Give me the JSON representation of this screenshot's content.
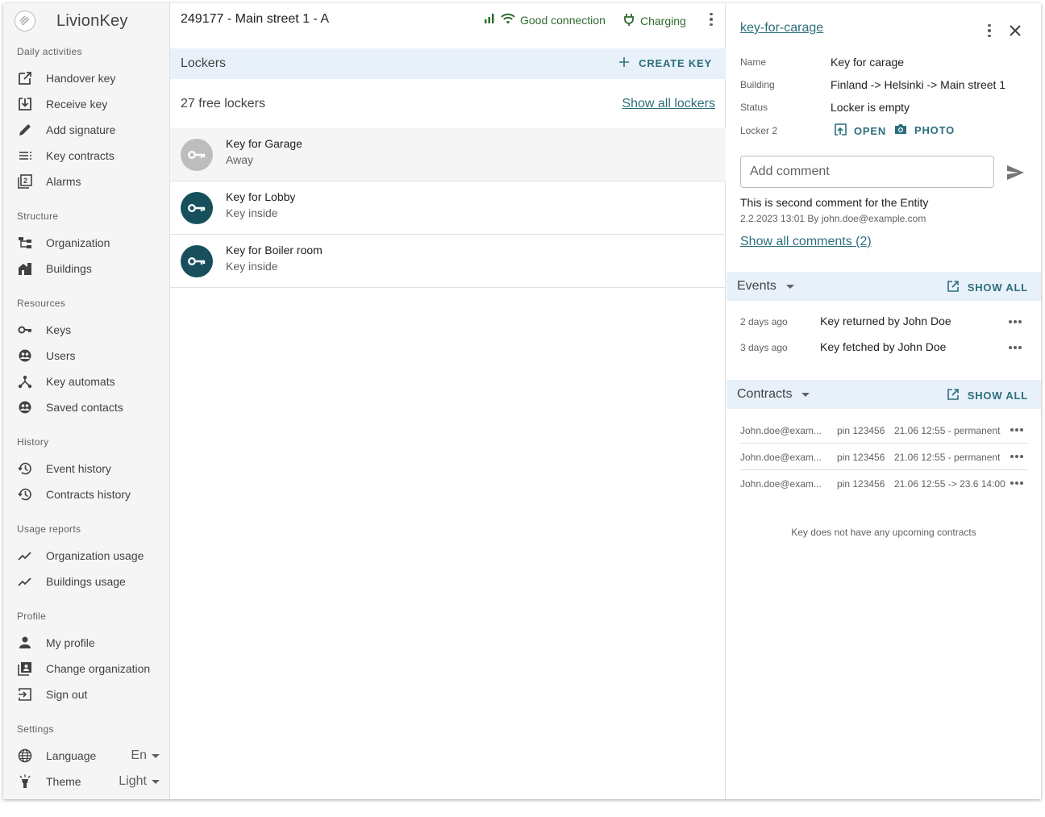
{
  "app": {
    "name": "LivionKey"
  },
  "sidebar": {
    "sections": [
      {
        "title": "Daily activities",
        "items": [
          {
            "label": "Handover key",
            "icon": "handover-icon"
          },
          {
            "label": "Receive key",
            "icon": "receive-icon"
          },
          {
            "label": "Add signature",
            "icon": "pencil-icon"
          },
          {
            "label": "Key contracts",
            "icon": "list-icon"
          },
          {
            "label": "Alarms",
            "icon": "alarm-icon"
          }
        ]
      },
      {
        "title": "Structure",
        "items": [
          {
            "label": "Organization",
            "icon": "organization-icon"
          },
          {
            "label": "Buildings",
            "icon": "buildings-icon"
          }
        ]
      },
      {
        "title": "Resources",
        "items": [
          {
            "label": "Keys",
            "icon": "key-icon"
          },
          {
            "label": "Users",
            "icon": "users-icon"
          },
          {
            "label": "Key automats",
            "icon": "automats-icon"
          },
          {
            "label": "Saved contacts",
            "icon": "contacts-icon"
          }
        ]
      },
      {
        "title": "History",
        "items": [
          {
            "label": "Event history",
            "icon": "history-icon"
          },
          {
            "label": "Contracts history",
            "icon": "history-icon"
          }
        ]
      },
      {
        "title": "Usage reports",
        "items": [
          {
            "label": "Organization usage",
            "icon": "trend-icon"
          },
          {
            "label": "Buildings usage",
            "icon": "trend-icon"
          }
        ]
      },
      {
        "title": "Profile",
        "items": [
          {
            "label": "My profile",
            "icon": "person-icon"
          },
          {
            "label": "Change organization",
            "icon": "switch-org-icon"
          },
          {
            "label": "Sign out",
            "icon": "sign-out-icon"
          }
        ]
      },
      {
        "title": "Settings",
        "items": [
          {
            "label": "Language",
            "icon": "globe-icon",
            "value": "En"
          },
          {
            "label": "Theme",
            "icon": "lamp-icon",
            "value": "Light"
          }
        ]
      }
    ]
  },
  "middle": {
    "title": "249177 - Main street 1 - A",
    "connection": "Good connection",
    "power": "Charging",
    "lockers_title": "Lockers",
    "create_key": "CREATE KEY",
    "free_lockers": "27 free lockers",
    "show_all_lockers": "Show all lockers",
    "keys": [
      {
        "name": "Key for Garage",
        "status": "Away",
        "away": true
      },
      {
        "name": "Key for Lobby",
        "status": "Key inside",
        "away": false
      },
      {
        "name": "Key for Boiler room",
        "status": "Key inside",
        "away": false
      }
    ]
  },
  "detail": {
    "title": "key-for-carage",
    "props": {
      "name_label": "Name",
      "name_value": "Key for carage",
      "building_label": "Building",
      "building_value": "Finland -> Helsinki -> Main street 1",
      "status_label": "Status",
      "status_value": "Locker is empty",
      "locker_label": "Locker 2"
    },
    "open": "OPEN",
    "photo": "PHOTO",
    "comment_placeholder": "Add comment",
    "comment_text": "This is second comment for the Entity",
    "comment_meta": "2.2.2023 13:01 By john.doe@example.com",
    "show_comments": "Show all comments (2)",
    "events_title": "Events",
    "show_all": "SHOW ALL",
    "events": [
      {
        "when": "2 days ago",
        "what": "Key returned by John Doe"
      },
      {
        "when": "3 days ago",
        "what": "Key fetched by John Doe"
      }
    ],
    "contracts_title": "Contracts",
    "contracts": [
      {
        "email": "John.doe@exam...",
        "pin": "pin 123456",
        "time": "21.06 12:55 - permanent"
      },
      {
        "email": "John.doe@exam...",
        "pin": "pin 123456",
        "time": "21.06 12:55 - permanent"
      },
      {
        "email": "John.doe@exam...",
        "pin": "pin 123456",
        "time": "21.06 12:55 -> 23.6 14:00"
      }
    ],
    "no_upcoming": "Key does not have any upcoming contracts"
  },
  "colors": {
    "accent": "#2c6e7c",
    "status_green": "#2e6b2e",
    "key_dark": "#17505c",
    "key_away": "#bdbdbd",
    "section_bar": "#e8f1fa"
  }
}
